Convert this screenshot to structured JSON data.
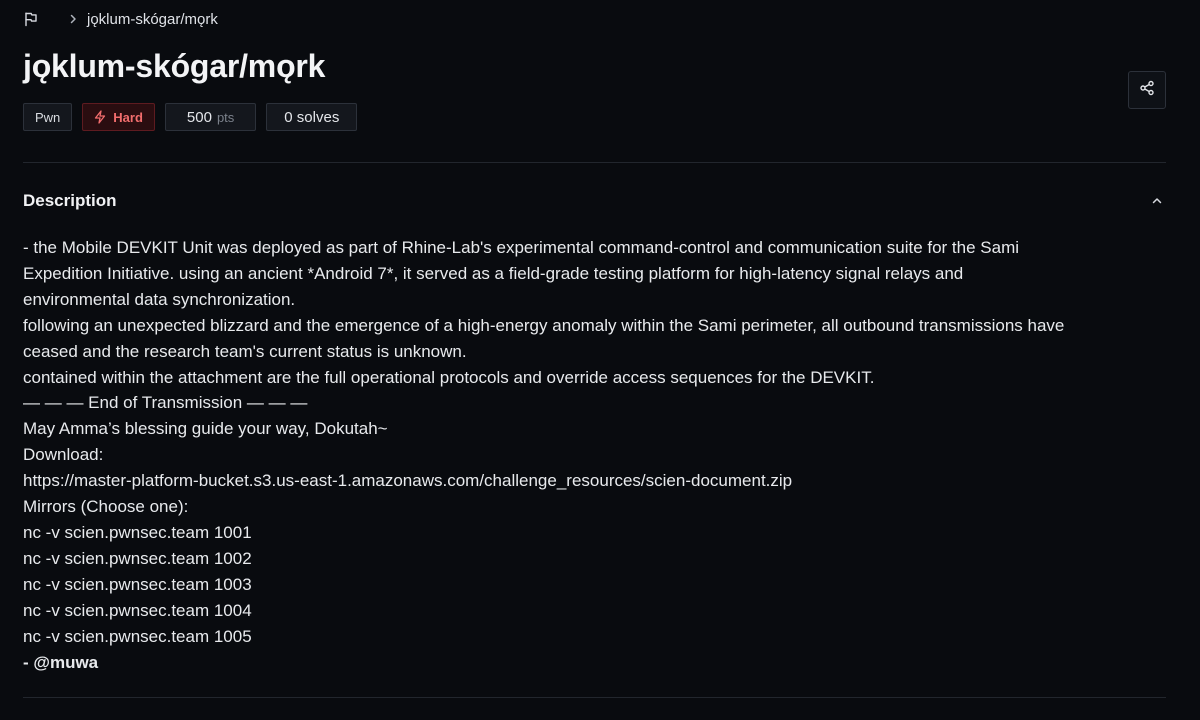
{
  "breadcrumb": {
    "flag_icon": "flag-icon",
    "separator_icon": "chevron-right-icon",
    "current": "jǫklum-skógar/mǫrk"
  },
  "challenge": {
    "title": "jǫklum-skógar/mǫrk",
    "category": "Pwn",
    "difficulty": "Hard",
    "difficulty_icon": "lightning-icon",
    "points": "500",
    "points_unit": "pts",
    "solves": "0 solves",
    "share_icon": "share-icon"
  },
  "colors": {
    "background": "#090b0f",
    "hard_text": "#f26d6d",
    "hard_bg": "#2a0d10",
    "border": "#2c313a"
  },
  "description": {
    "title": "Description",
    "toggle_icon": "chevron-up-icon",
    "lines": [
      "- the Mobile DEVKIT Unit was deployed as part of Rhine-Lab's experimental command-control and communication suite for the Sami",
      "Expedition Initiative. using an ancient *Android 7*, it served as a field-grade testing platform for high-latency signal relays and",
      "environmental data synchronization.",
      "following an unexpected blizzard and the emergence of a high-energy anomaly within the Sami perimeter, all outbound transmissions have",
      "ceased and the research team's current status is unknown.",
      "contained within the attachment are the full operational protocols and override access sequences for the DEVKIT.",
      "— — — End of Transmission — — —",
      "May Amma’s blessing guide your way, Dokutah~",
      "Download:",
      "https://master-platform-bucket.s3.us-east-1.amazonaws.com/challenge_resources/scien-document.zip",
      "Mirrors (Choose one):",
      "nc -v scien.pwnsec.team 1001",
      "nc -v scien.pwnsec.team 1002",
      "nc -v scien.pwnsec.team 1003",
      "nc -v scien.pwnsec.team 1004",
      "nc -v scien.pwnsec.team 1005"
    ],
    "signature": "- @muwa"
  }
}
